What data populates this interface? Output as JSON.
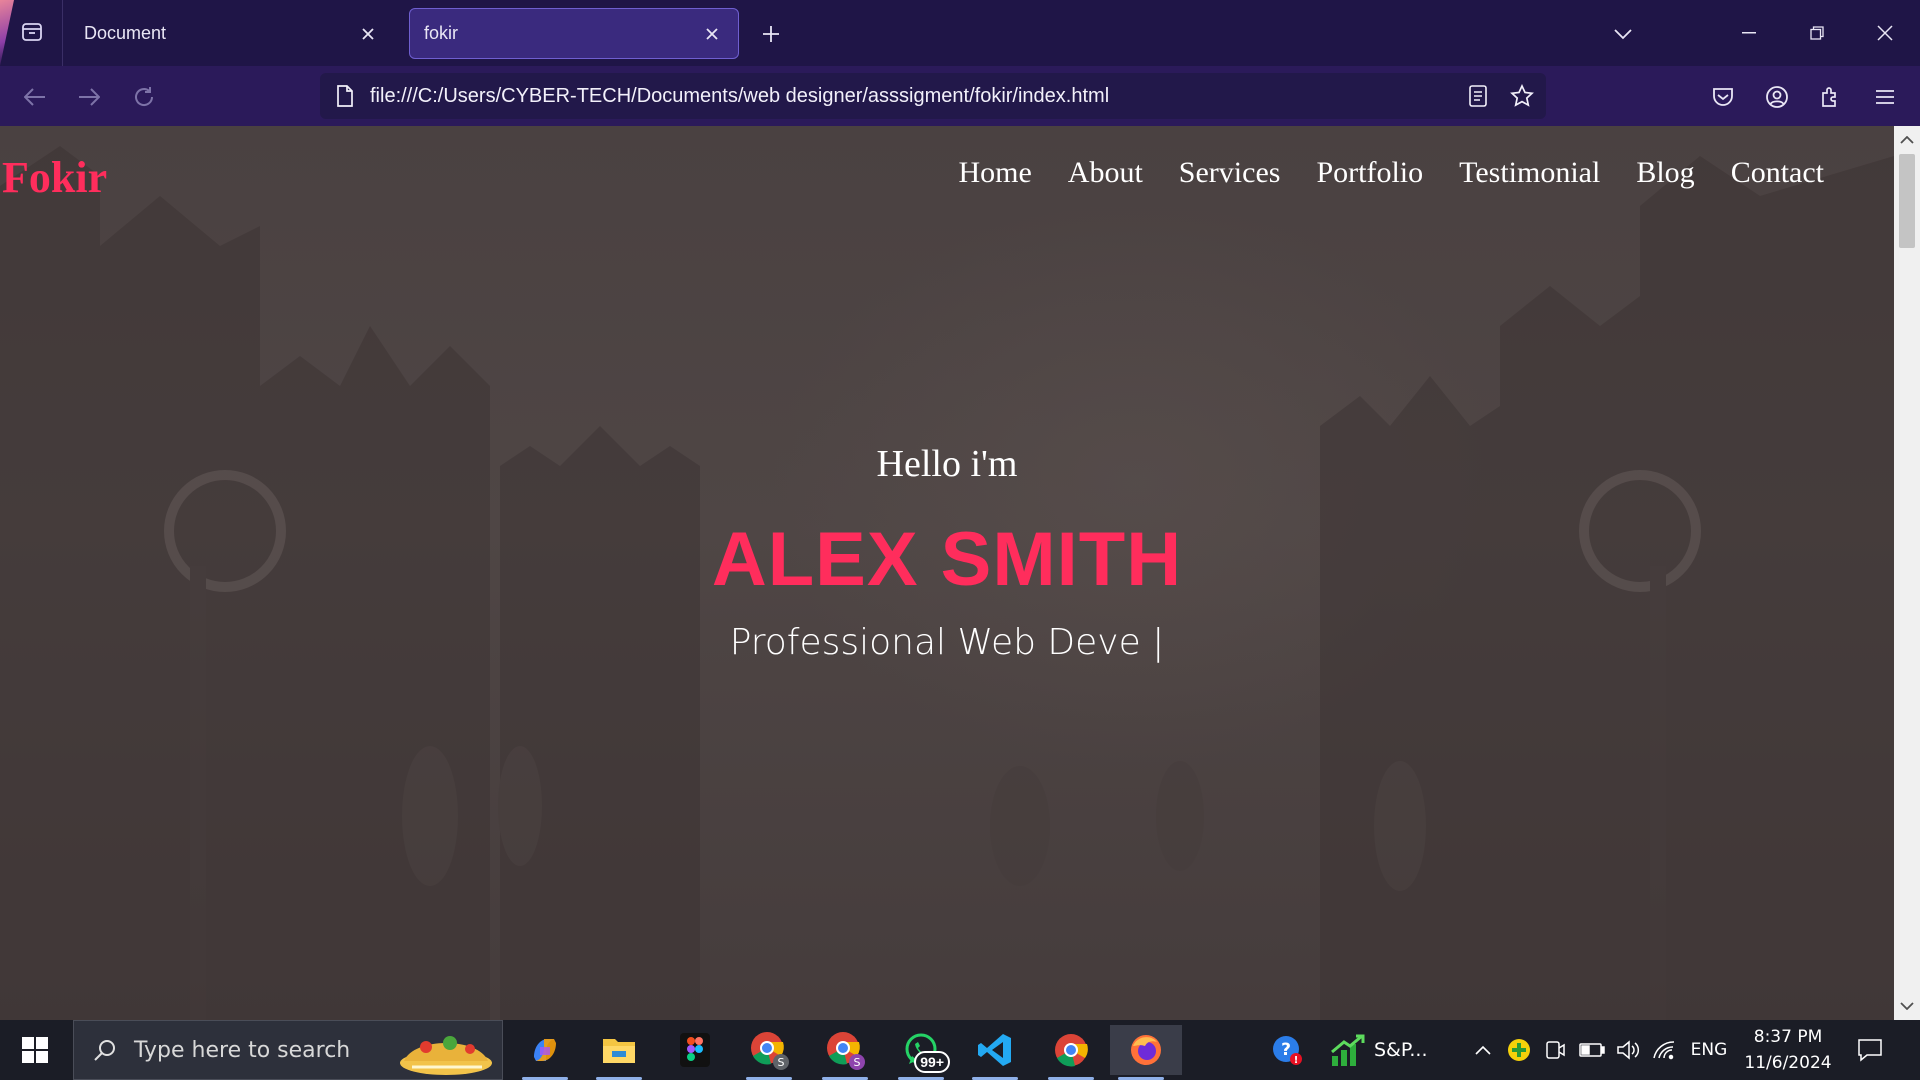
{
  "browser": {
    "tabs": [
      {
        "title": "Document",
        "active": false
      },
      {
        "title": "fokir",
        "active": true
      }
    ],
    "url": "file:///C:/Users/CYBER-TECH/Documents/web designer/asssigment/fokir/index.html",
    "accent_color": "#3a2a7e"
  },
  "site": {
    "logo": "Fokir",
    "nav": [
      "Home",
      "About",
      "Services",
      "Portfolio",
      "Testimonial",
      "Blog",
      "Contact"
    ],
    "hero": {
      "greeting": "Hello i'm",
      "name": "ALEX SMITH",
      "role": "Professional Web Deve |"
    },
    "accent_color": "#ff2d5c"
  },
  "taskbar": {
    "search_placeholder": "Type here to search",
    "apps": [
      "copilot-icon",
      "file-explorer-icon",
      "figma-icon",
      "chrome-profile-s-icon",
      "chrome-profile-s2-icon",
      "whatsapp-icon",
      "vscode-icon",
      "chrome-icon",
      "firefox-icon"
    ],
    "whatsapp_badge": "99+",
    "stock_label": "S&P...",
    "language": "ENG",
    "time": "8:37 PM",
    "date": "11/6/2024"
  }
}
